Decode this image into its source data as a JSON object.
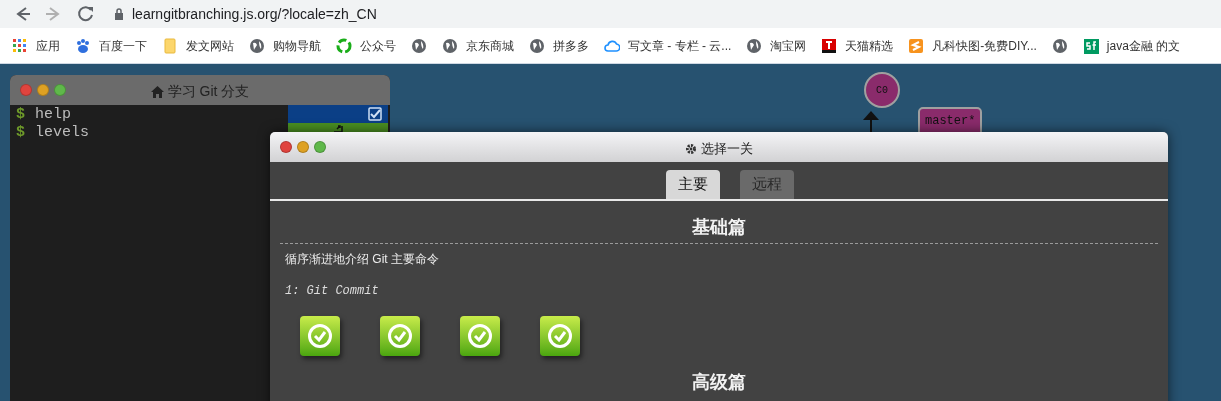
{
  "browser": {
    "nav": [
      {
        "kind": "back",
        "disabled": false
      },
      {
        "kind": "forward",
        "disabled": true
      },
      {
        "kind": "reload",
        "disabled": false
      }
    ],
    "url": "learngitbranching.js.org/?locale=zh_CN",
    "bookmarks": [
      {
        "kind": "apps",
        "label": "应用"
      },
      {
        "kind": "paw",
        "label": "百度一下"
      },
      {
        "kind": "folder",
        "label": "发文网站"
      },
      {
        "kind": "globe",
        "label": "购物导航"
      },
      {
        "kind": "ring",
        "label": "公众号"
      },
      {
        "kind": "globe"
      },
      {
        "kind": "globe",
        "label": "京东商城"
      },
      {
        "kind": "globe",
        "label": "拼多多"
      },
      {
        "kind": "cloud",
        "label": "写文章 - 专栏 - 云..."
      },
      {
        "kind": "globe",
        "label": "淘宝网"
      },
      {
        "kind": "tmall",
        "label": "天猫精选"
      },
      {
        "kind": "s-logo",
        "label": "凡科快图-免费DIY..."
      },
      {
        "kind": "globe"
      },
      {
        "kind": "sf",
        "label": "java金融 的文"
      }
    ]
  },
  "terminal": {
    "title": "学习 Git 分支",
    "lines": [
      {
        "prompt": "$",
        "command": "help"
      },
      {
        "prompt": "$",
        "command": "levels"
      }
    ]
  },
  "git_tree": {
    "commits": [
      {
        "label": "C0"
      }
    ],
    "branches": [
      {
        "label": "master*"
      }
    ]
  },
  "level_dialog": {
    "title": "选择一关",
    "tabs": [
      {
        "label": "主要",
        "selected": true
      },
      {
        "label": "远程",
        "selected": false
      }
    ],
    "sections": [
      {
        "heading": "基础篇",
        "description": "循序渐进地介绍 Git 主要命令",
        "level_title": "1: Git Commit",
        "levels": [
          {
            "completed": true
          },
          {
            "completed": true
          },
          {
            "completed": true
          },
          {
            "completed": true
          }
        ]
      },
      {
        "heading": "高级篇"
      }
    ]
  }
}
